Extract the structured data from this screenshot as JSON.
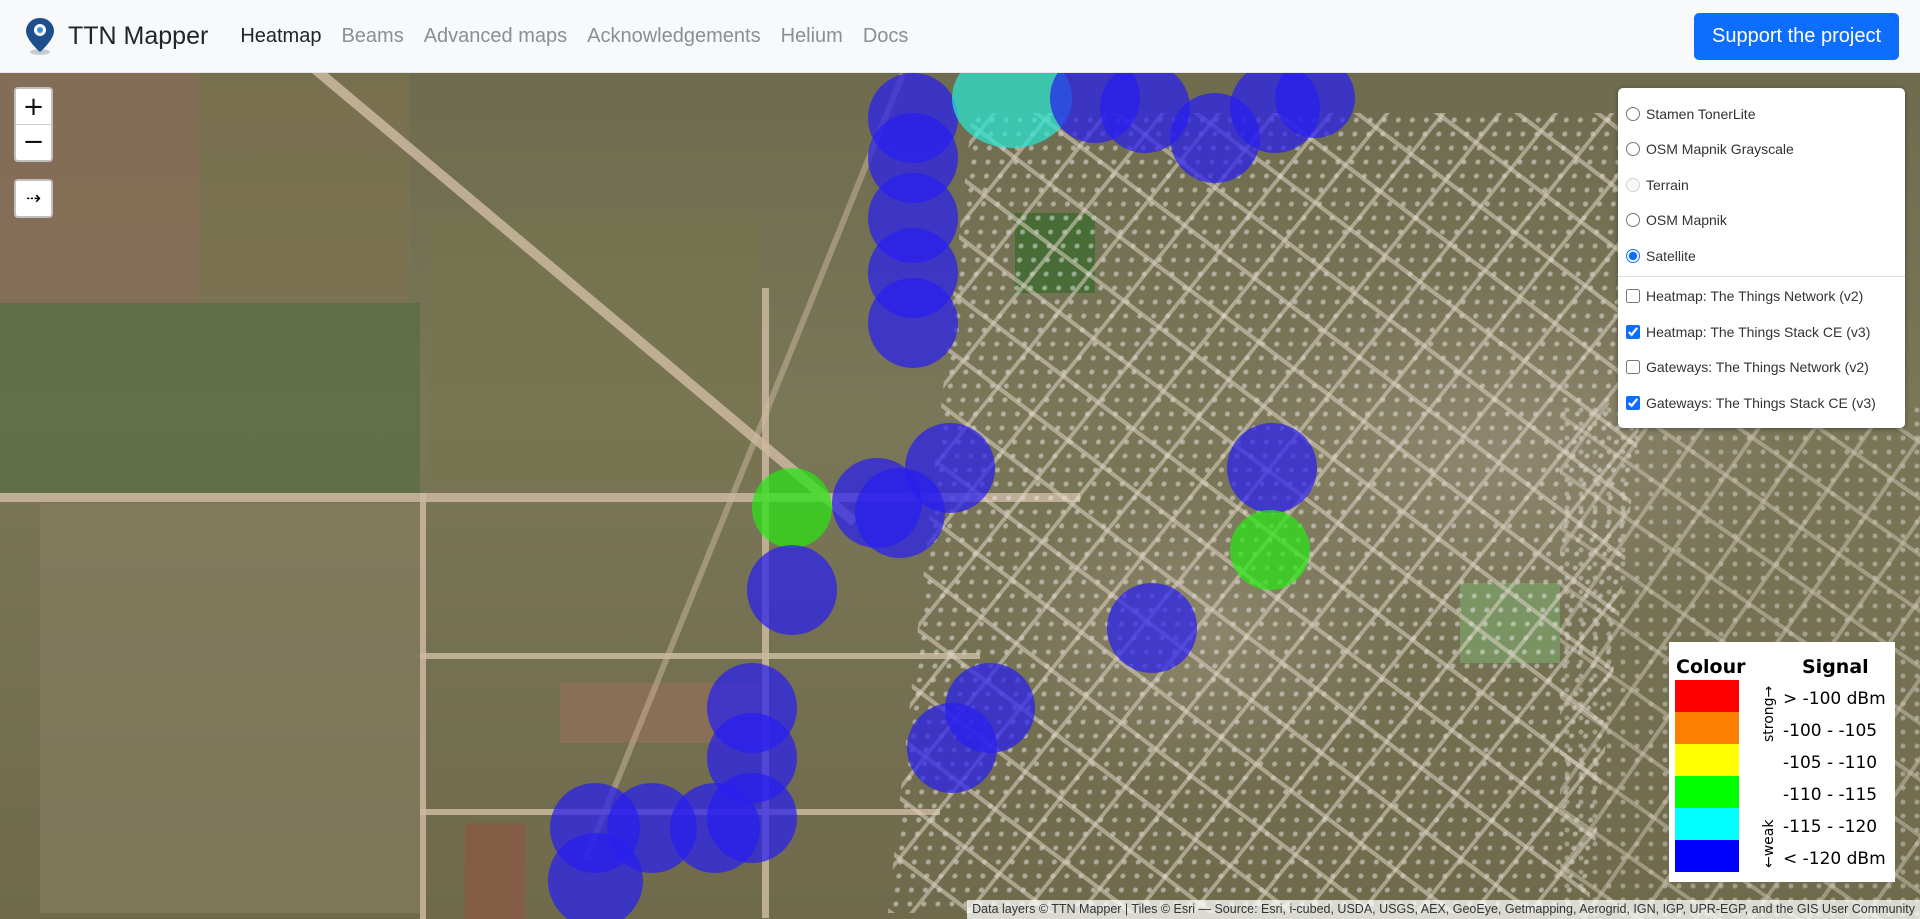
{
  "brand": {
    "name": "TTN Mapper"
  },
  "nav": {
    "items": [
      {
        "label": "Heatmap"
      },
      {
        "label": "Beams"
      },
      {
        "label": "Advanced maps"
      },
      {
        "label": "Acknowledgements"
      },
      {
        "label": "Helium"
      },
      {
        "label": "Docs"
      }
    ],
    "active": "Heatmap",
    "support_label": "Support the project"
  },
  "colors": {
    "accent": "#0d6efd",
    "heat_blue": "#2b1ef0",
    "heat_green": "#28e614",
    "heat_cyan": "#28e6d2"
  },
  "zoom": {
    "in_label": "+",
    "out_label": "−",
    "expand_label": "⇢"
  },
  "layers": {
    "base": [
      {
        "label": "Stamen TonerLite",
        "checked": false,
        "disabled": false
      },
      {
        "label": "OSM Mapnik Grayscale",
        "checked": false,
        "disabled": false
      },
      {
        "label": "Terrain",
        "checked": false,
        "disabled": true
      },
      {
        "label": "OSM Mapnik",
        "checked": false,
        "disabled": false
      },
      {
        "label": "Satellite",
        "checked": true,
        "disabled": false
      }
    ],
    "overlays": [
      {
        "label": "Heatmap: The Things Network (v2)",
        "checked": false
      },
      {
        "label": "Heatmap: The Things Stack CE (v3)",
        "checked": true
      },
      {
        "label": "Gateways: The Things Network (v2)",
        "checked": false
      },
      {
        "label": "Gateways: The Things Stack CE (v3)",
        "checked": true
      }
    ]
  },
  "legend": {
    "colour_header": "Colour",
    "signal_header": "Signal",
    "strong_label": "strong→",
    "weak_label": "←weak",
    "rows": [
      {
        "color": "#ff0000",
        "range": "> -100 dBm"
      },
      {
        "color": "#ff8000",
        "range": "-100 - -105"
      },
      {
        "color": "#ffff00",
        "range": "-105 - -110"
      },
      {
        "color": "#00ff00",
        "range": "-110 - -115"
      },
      {
        "color": "#00ffff",
        "range": "-115 - -120"
      },
      {
        "color": "#0000ff",
        "range": "< -120 dBm"
      }
    ]
  },
  "attribution": "Data layers © TTN Mapper | Tiles © Esri — Source: Esri, i-cubed, USDA, USGS, AEX, GeoEye, Getmapping, Aerogrid, IGN, IGP, UPR-EGP, and the GIS User Community"
}
